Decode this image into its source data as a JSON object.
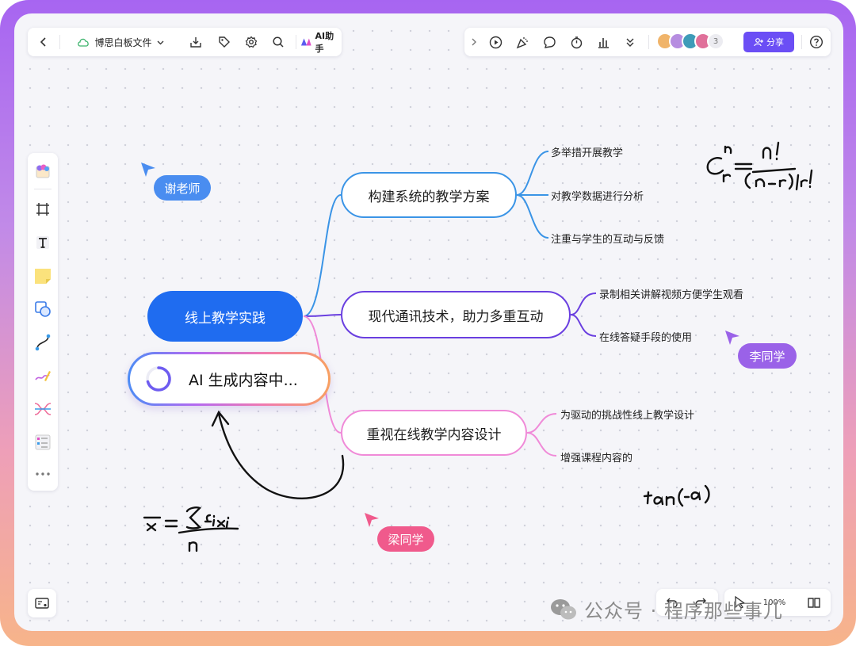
{
  "colors": {
    "accent": "#6b4ef5",
    "root": "#1f6cf0",
    "branch1": "#3a94e6",
    "branch2": "#6a3fe0",
    "branch3": "#f08ad8"
  },
  "toolbar": {
    "back_icon": "chevron-left-icon",
    "cloud_icon": "cloud-icon",
    "file_name": "博思白板文件",
    "ai_label": "AI助手",
    "avatar_count": "3",
    "share_label": "分享"
  },
  "mindmap": {
    "root": "线上教学实践",
    "branches": [
      {
        "label": "构建系统的教学方案",
        "leaves": [
          "多举措开展教学",
          "对教学数据进行分析",
          "注重与学生的互动与反馈"
        ]
      },
      {
        "label": "现代通讯技术，助力多重互动",
        "leaves": [
          "录制相关讲解视频方便学生观看",
          "在线答疑手段的使用"
        ]
      },
      {
        "label": "重视在线教学内容设计",
        "leaves": [
          "为驱动的挑战性线上教学设计",
          "增强课程内容的"
        ]
      }
    ]
  },
  "ai_status": "AI 生成内容中...",
  "collaborators": [
    {
      "name": "谢老师",
      "color": "#4a8df0"
    },
    {
      "name": "李同学",
      "color": "#9a62e8"
    },
    {
      "name": "梁同学",
      "color": "#f05a8c"
    }
  ],
  "bottom_toolbar": {
    "zoom": "100%"
  },
  "watermark": "公众号 · 程序那些事儿"
}
